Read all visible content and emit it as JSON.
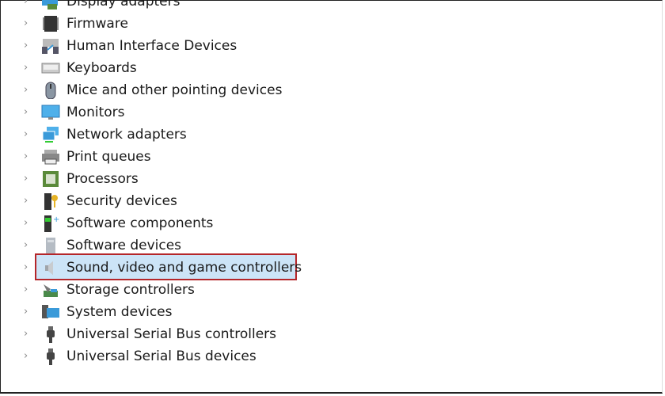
{
  "tree": {
    "items": [
      {
        "label": "Display adapters",
        "icon": "display-adapter-icon"
      },
      {
        "label": "Firmware",
        "icon": "firmware-chip-icon"
      },
      {
        "label": "Human Interface Devices",
        "icon": "hid-icon"
      },
      {
        "label": "Keyboards",
        "icon": "keyboard-icon"
      },
      {
        "label": "Mice and other pointing devices",
        "icon": "mouse-icon"
      },
      {
        "label": "Monitors",
        "icon": "monitor-icon"
      },
      {
        "label": "Network adapters",
        "icon": "network-icon"
      },
      {
        "label": "Print queues",
        "icon": "printer-icon"
      },
      {
        "label": "Processors",
        "icon": "processor-icon"
      },
      {
        "label": "Security devices",
        "icon": "security-key-icon"
      },
      {
        "label": "Software components",
        "icon": "software-component-icon"
      },
      {
        "label": "Software devices",
        "icon": "software-device-icon"
      },
      {
        "label": "Sound, video and game controllers",
        "icon": "speaker-icon",
        "selected": true
      },
      {
        "label": "Storage controllers",
        "icon": "storage-icon"
      },
      {
        "label": "System devices",
        "icon": "system-icon"
      },
      {
        "label": "Universal Serial Bus controllers",
        "icon": "usb-icon"
      },
      {
        "label": "Universal Serial Bus devices",
        "icon": "usb-icon"
      }
    ]
  },
  "colors": {
    "selection_fill": "#cce4f7",
    "highlight_border": "#b5262a"
  }
}
